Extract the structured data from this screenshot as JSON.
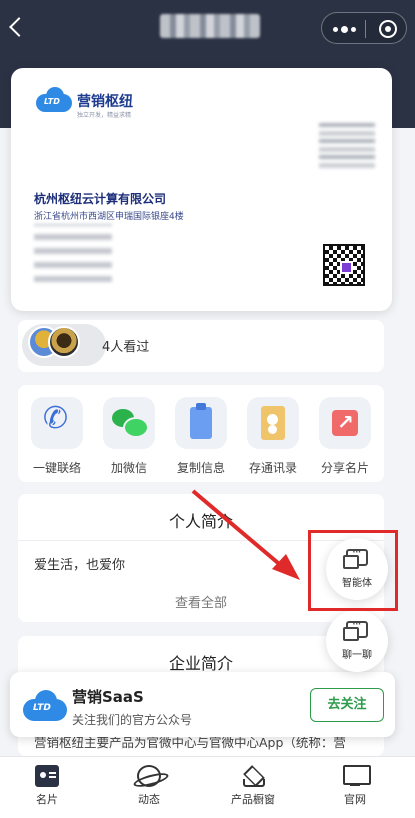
{
  "header": {
    "back_icon": "chevron-left-icon",
    "title_blurred": true,
    "capsule": {
      "more_icon": "more-dots-icon",
      "close_icon": "target-circle-icon"
    }
  },
  "card": {
    "brand_name": "营销枢纽",
    "brand_slogan": "独立开发，精益求精",
    "logo_text": "LTD",
    "company": "杭州枢纽云计算有限公司",
    "address": "浙江省杭州市西湖区申瑞国际银座4楼"
  },
  "viewers": {
    "count_text": "4人看过"
  },
  "actions": [
    {
      "label": "一键联络",
      "icon": "phone-icon"
    },
    {
      "label": "加微信",
      "icon": "wechat-icon"
    },
    {
      "label": "复制信息",
      "icon": "clipboard-icon"
    },
    {
      "label": "存通讯录",
      "icon": "contacts-book-icon"
    },
    {
      "label": "分享名片",
      "icon": "share-icon"
    }
  ],
  "intro": {
    "title": "个人简介",
    "body": "爱生活，也爱你",
    "more": "查看全部"
  },
  "company_intro": {
    "title": "企业简介",
    "text": "营销枢纽主要产品为官微中心与官微中心App（统称：营"
  },
  "follow": {
    "logo_text": "LTD",
    "name": "营销SaaS",
    "sub": "关注我们的官方公众号",
    "button": "去关注"
  },
  "fabs": {
    "agent": "智能体",
    "chat": "聊一聊"
  },
  "nav": [
    {
      "label": "名片",
      "icon": "card-icon"
    },
    {
      "label": "动态",
      "icon": "planet-icon"
    },
    {
      "label": "产品橱窗",
      "icon": "layers-icon"
    },
    {
      "label": "官网",
      "icon": "monitor-icon"
    }
  ],
  "colors": {
    "header_bg": "#2a3244",
    "brand_blue": "#1d3b8f",
    "follow_green": "#2d9b4a",
    "annotation_red": "#e02a2a"
  }
}
